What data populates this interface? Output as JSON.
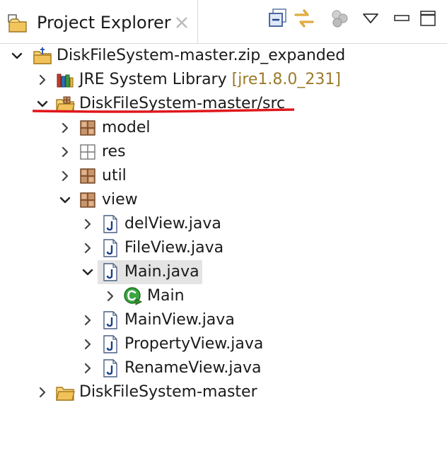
{
  "view": {
    "title": "Project Explorer"
  },
  "toolbar": {
    "buttons": [
      {
        "name": "collapse-all-icon"
      },
      {
        "name": "link-with-editor-icon"
      },
      {
        "name": "working-sets-icon"
      },
      {
        "name": "view-menu-chevron-icon"
      },
      {
        "name": "minimize-icon"
      },
      {
        "name": "maximize-icon"
      }
    ]
  },
  "tree": {
    "rows": [
      {
        "label": "DiskFileSystem-master.zip_expanded",
        "icon": "project-folder-icon",
        "expanded": true
      },
      {
        "label": "JRE System Library",
        "decoration": "[jre1.8.0_231]",
        "icon": "library-icon",
        "expanded": false
      },
      {
        "label": "DiskFileSystem-master/src",
        "icon": "source-folder-icon",
        "expanded": true
      },
      {
        "label": "model",
        "icon": "package-icon",
        "expanded": false
      },
      {
        "label": "res",
        "icon": "empty-package-icon",
        "expanded": false
      },
      {
        "label": "util",
        "icon": "package-icon",
        "expanded": false
      },
      {
        "label": "view",
        "icon": "package-icon",
        "expanded": true
      },
      {
        "label": "delView.java",
        "icon": "java-file-icon",
        "expanded": false
      },
      {
        "label": "FileView.java",
        "icon": "java-file-icon",
        "expanded": false
      },
      {
        "label": "Main.java",
        "icon": "java-file-icon",
        "expanded": true,
        "selected": true
      },
      {
        "label": "Main",
        "icon": "class-icon",
        "expanded": false
      },
      {
        "label": "MainView.java",
        "icon": "java-file-icon",
        "expanded": false
      },
      {
        "label": "PropertyView.java",
        "icon": "java-file-icon",
        "expanded": false
      },
      {
        "label": "RenameView.java",
        "icon": "java-file-icon",
        "expanded": false
      },
      {
        "label": "DiskFileSystem-master",
        "icon": "folder-icon",
        "expanded": false
      }
    ]
  },
  "colors": {
    "annotation_underline": "#e0161b",
    "selection_bg": "#e4e4e4",
    "decoration_text": "#9b7a2a"
  }
}
